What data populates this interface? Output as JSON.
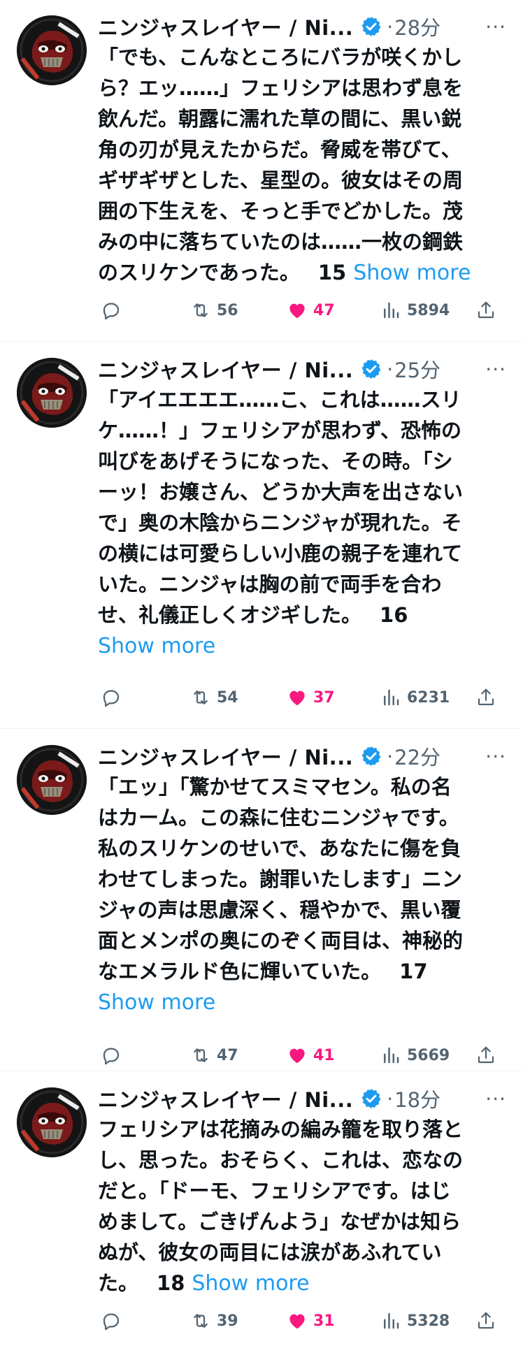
{
  "colors": {
    "accent": "#1d9bf0",
    "like": "#f91880",
    "muted": "#536471",
    "text": "#0f1419"
  },
  "tweets": [
    {
      "author": "ニンジャスレイヤー / Ni...",
      "dot": "·",
      "time": "28分",
      "more": "···",
      "lines": [
        "「でも、こんなところにバラが咲くかし",
        "ら？エッ……」フェリシアは思わず息を",
        "飲んだ。朝露に濡れた草の間に、黒い鋭",
        "角の刃が見えたからだ。脅威を帯びて、",
        "ギザギザとした、星型の。彼女はその周",
        "囲の下生えを、そっと手でどかした。茂",
        "みの中に落ちていたのは……一枚の鋼鉄",
        "のスリケンであった。"
      ],
      "number": "15",
      "show_more": "Show more",
      "replies": "",
      "retweets": "56",
      "likes": "47",
      "views": "5894"
    },
    {
      "author": "ニンジャスレイヤー / Ni...",
      "dot": "·",
      "time": "25分",
      "more": "···",
      "lines": [
        "「アイエエエエ……こ、これは……スリ",
        "ケ……！」フェリシアが思わず、恐怖の",
        "叫びをあげそうになった、その時。「シ",
        "ーッ！お嬢さん、どうか大声を出さない",
        "で」奥の木陰からニンジャが現れた。そ",
        "の横には可愛らしい小鹿の親子を連れて",
        "いた。ニンジャは胸の前で両手を合わ",
        "せ、礼儀正しくオジギした。"
      ],
      "number": "16",
      "show_more": "Show more",
      "replies": "",
      "retweets": "54",
      "likes": "37",
      "views": "6231"
    },
    {
      "author": "ニンジャスレイヤー / Ni...",
      "dot": "·",
      "time": "22分",
      "more": "···",
      "lines": [
        "「エッ」「驚かせてスミマセン。私の名",
        "はカーム。この森に住むニンジャです。",
        "私のスリケンのせいで、あなたに傷を負",
        "わせてしまった。謝罪いたします」ニン",
        "ジャの声は思慮深く、穏やかで、黒い覆",
        "面とメンポの奥にのぞく両目は、神秘的",
        "なエメラルド色に輝いていた。"
      ],
      "number": "17",
      "show_more": "Show more",
      "replies": "",
      "retweets": "47",
      "likes": "41",
      "views": "5669"
    },
    {
      "author": "ニンジャスレイヤー / Ni...",
      "dot": "·",
      "time": "18分",
      "more": "···",
      "lines": [
        "フェリシアは花摘みの編み籠を取り落と",
        "し、思った。おそらく、これは、恋なの",
        "だと。「ドーモ、フェリシアです。はじ",
        "めまして。ごきげんよう」なぜかは知ら",
        "ぬが、彼女の両目には涙があふれてい",
        "た。"
      ],
      "number": "18",
      "show_more": "Show more",
      "replies": "",
      "retweets": "39",
      "likes": "31",
      "views": "5328"
    }
  ]
}
